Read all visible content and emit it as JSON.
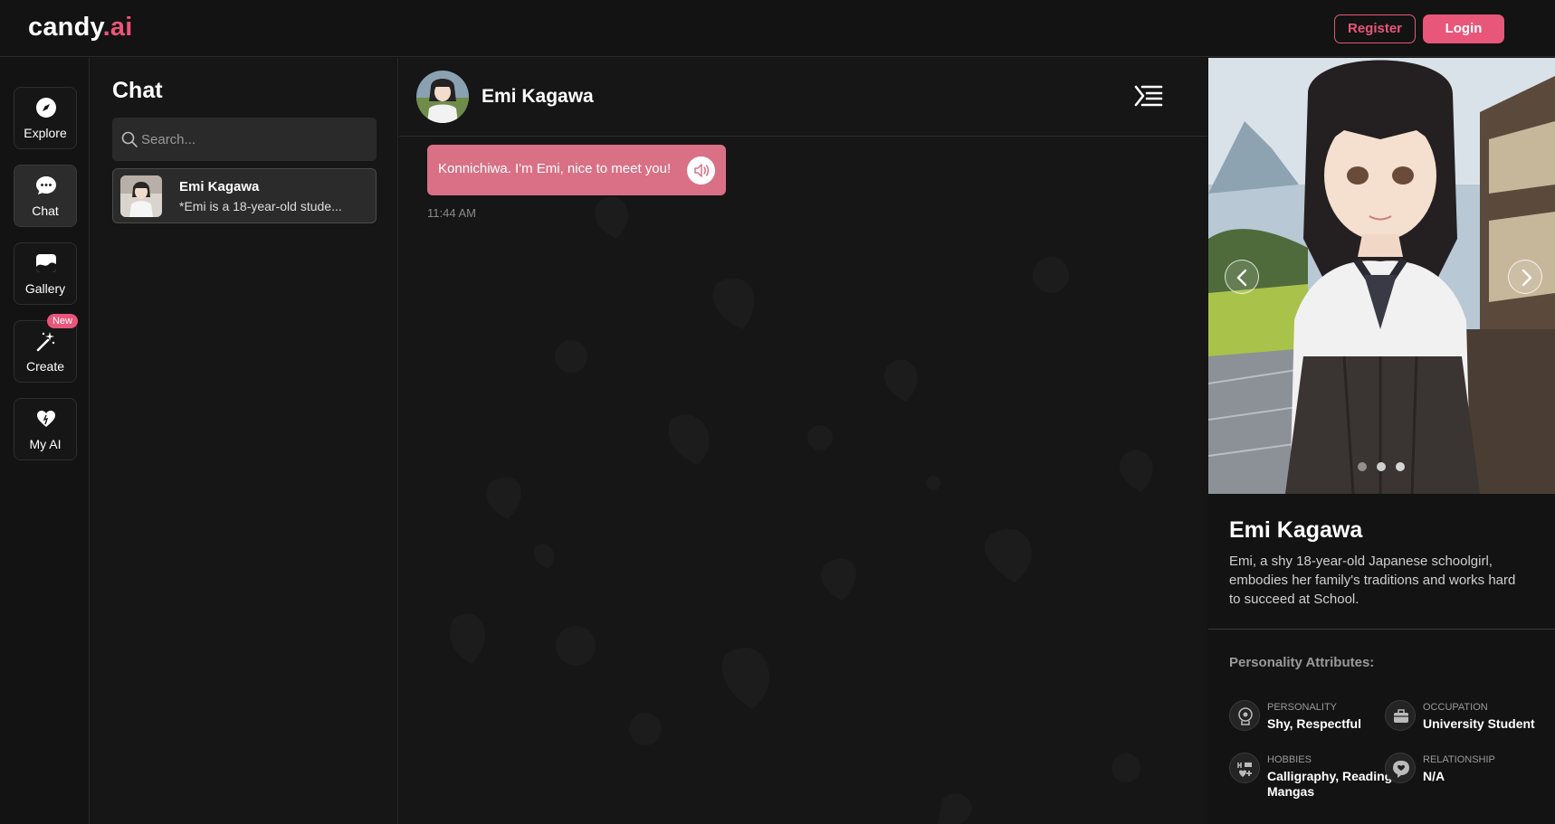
{
  "app": {
    "logo_main": "candy",
    "logo_dot": ".ai"
  },
  "header": {
    "register_label": "Register",
    "login_label": "Login"
  },
  "nav": {
    "items": [
      {
        "label": "Explore",
        "icon": "compass-icon"
      },
      {
        "label": "Chat",
        "icon": "chat-bubble-icon"
      },
      {
        "label": "Gallery",
        "icon": "image-icon"
      },
      {
        "label": "Create",
        "icon": "magic-wand-icon",
        "badge": "New"
      },
      {
        "label": "My AI",
        "icon": "heart-icon"
      }
    ]
  },
  "chat_list": {
    "title": "Chat",
    "search_placeholder": "Search...",
    "conversations": [
      {
        "name": "Emi Kagawa",
        "preview": "*Emi is a 18-year-old stude..."
      }
    ]
  },
  "conversation": {
    "name": "Emi Kagawa",
    "messages": [
      {
        "text": "Konnichiwa. I'm Emi, nice to meet you!",
        "time": "11:44 AM"
      }
    ]
  },
  "profile": {
    "name": "Emi Kagawa",
    "description": "Emi, a shy 18-year-old Japanese schoolgirl, embodies her family's traditions and works hard to succeed at School.",
    "attributes_heading": "Personality Attributes:",
    "attributes": [
      {
        "key": "PERSONALITY",
        "value": "Shy, Respectful",
        "icon": "personality-icon"
      },
      {
        "key": "OCCUPATION",
        "value": "University Student",
        "icon": "briefcase-icon"
      },
      {
        "key": "HOBBIES",
        "value": "Calligraphy, Reading Mangas",
        "icon": "hobbies-icon"
      },
      {
        "key": "RELATIONSHIP",
        "value": "N/A",
        "icon": "relationship-icon"
      }
    ],
    "carousel_count": 3,
    "carousel_active": 1
  },
  "colors": {
    "accent": "#e8567a",
    "bubble": "#d97086",
    "background": "#131313"
  }
}
